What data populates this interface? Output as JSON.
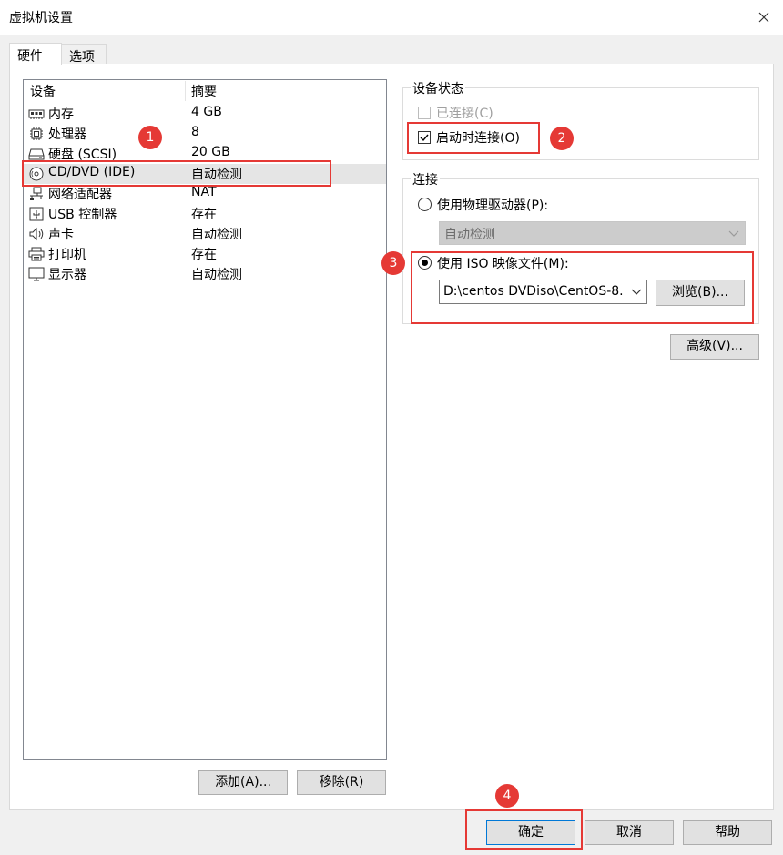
{
  "window": {
    "title": "虚拟机设置",
    "close_icon": "close-icon"
  },
  "tabs": [
    {
      "label": "硬件",
      "active": true
    },
    {
      "label": "选项",
      "active": false
    }
  ],
  "device_list": {
    "headers": {
      "device": "设备",
      "summary": "摘要"
    },
    "rows": [
      {
        "icon": "memory-icon",
        "name": "内存",
        "value": "4 GB"
      },
      {
        "icon": "processor-icon",
        "name": "处理器",
        "value": "8"
      },
      {
        "icon": "hard-disk-icon",
        "name": "硬盘 (SCSI)",
        "value": "20 GB"
      },
      {
        "icon": "cd-dvd-icon",
        "name": "CD/DVD (IDE)",
        "value": "自动检测",
        "selected": true
      },
      {
        "icon": "network-adapter-icon",
        "name": "网络适配器",
        "value": "NAT"
      },
      {
        "icon": "usb-icon",
        "name": "USB 控制器",
        "value": "存在"
      },
      {
        "icon": "sound-icon",
        "name": "声卡",
        "value": "自动检测"
      },
      {
        "icon": "printer-icon",
        "name": "打印机",
        "value": "存在"
      },
      {
        "icon": "display-icon",
        "name": "显示器",
        "value": "自动检测"
      }
    ],
    "add_button": "添加(A)...",
    "remove_button": "移除(R)"
  },
  "device_status": {
    "group_label": "设备状态",
    "connected": {
      "label": "已连接(C)",
      "checked": false,
      "enabled": false
    },
    "connect_at_power_on": {
      "label": "启动时连接(O)",
      "checked": true
    }
  },
  "connection": {
    "group_label": "连接",
    "physical_drive": {
      "label": "使用物理驱动器(P):",
      "selected": false,
      "combo_value": "自动检测"
    },
    "iso_image": {
      "label": "使用 ISO 映像文件(M):",
      "selected": true,
      "path_value": "D:\\centos DVDiso\\CentOS-8.1.",
      "browse_button": "浏览(B)..."
    }
  },
  "advanced_button": "高级(V)...",
  "footer": {
    "ok": "确定",
    "cancel": "取消",
    "help": "帮助"
  },
  "annotations": [
    "1",
    "2",
    "3",
    "4"
  ],
  "colors": {
    "annotation_red": "#e53935",
    "selection_bg": "#e5e5e5",
    "dialog_bg": "#f0f0f0"
  }
}
